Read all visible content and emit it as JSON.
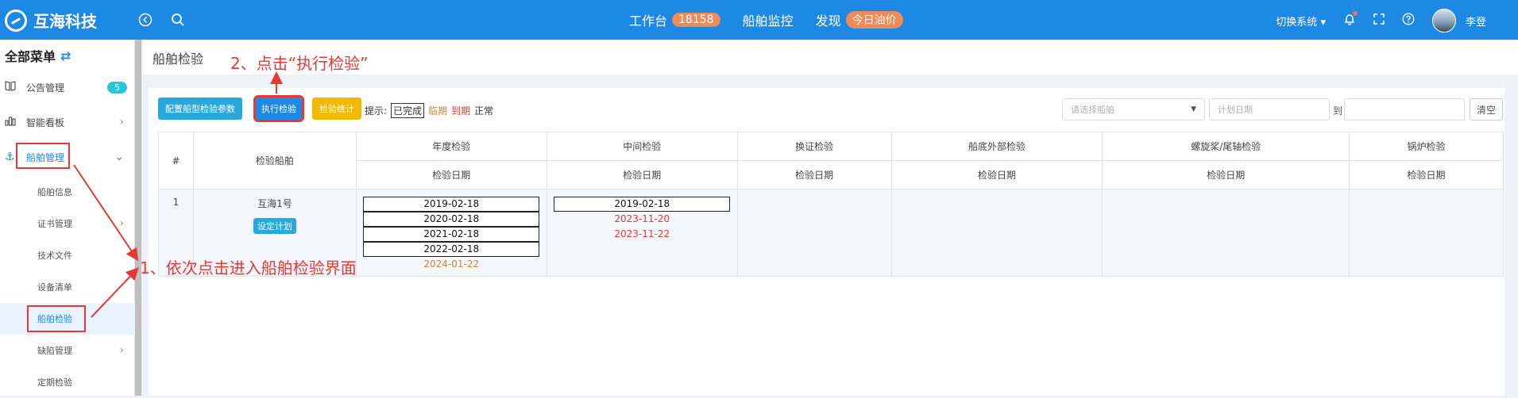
{
  "header": {
    "brand": "互海科技",
    "nav": [
      {
        "label": "工作台",
        "badge": "18158"
      },
      {
        "label": "船舶监控",
        "badge": ""
      },
      {
        "label": "发现",
        "badge": "今日油价"
      }
    ],
    "switch_system": "切换系统",
    "user_name": "李登"
  },
  "sidebar": {
    "title": "全部菜单",
    "items": [
      {
        "label": "公告管理",
        "badge": "5",
        "icon": "book-icon"
      },
      {
        "label": "智能看板",
        "icon": "bar-chart-icon"
      },
      {
        "label": "船舶管理",
        "icon": "anchor-icon"
      }
    ],
    "sub_items": [
      {
        "label": "船舶信息"
      },
      {
        "label": "证书管理"
      },
      {
        "label": "技术文件"
      },
      {
        "label": "设备清单"
      },
      {
        "label": "船舶检验"
      },
      {
        "label": "缺陷管理"
      },
      {
        "label": "定期检验"
      }
    ]
  },
  "page": {
    "title": "船舶检验",
    "toolbar": {
      "config_btn": "配置船型检验参数",
      "execute_btn": "执行检验",
      "stats_btn": "检验统计",
      "hint_label": "提示:",
      "legend_done": "已完成",
      "legend_due_soon": "临期",
      "legend_expired": "到期",
      "legend_normal": "正常",
      "ship_select_placeholder": "请选择船舶",
      "plan_date_placeholder": "计划日期",
      "to_label": "到",
      "reset_btn": "清空"
    },
    "table": {
      "col_index": "#",
      "col_ship": "检验船舶",
      "groups": [
        "年度检验",
        "中间检验",
        "换证检验",
        "船底外部检验",
        "螺旋桨/尾轴检验",
        "锅炉检验"
      ],
      "sub_header": "检验日期",
      "rows": [
        {
          "index": "1",
          "ship": "互海1号",
          "plan_btn": "设定计划",
          "annual_done": [
            "2019-02-18",
            "2020-02-18",
            "2021-02-18",
            "2022-02-18"
          ],
          "annual_upcoming": "2024-01-22",
          "intermediate_done": [
            "2019-02-18"
          ],
          "intermediate_due": [
            "2023-11-20",
            "2023-11-22"
          ]
        }
      ]
    }
  },
  "annotations": {
    "step1": "1、依次点击进入船舶检验界面",
    "step2": "2、点击“执行检验”"
  },
  "colors": {
    "primary": "#1e88e5",
    "annotation": "#e53935",
    "warning_btn": "#f5b800",
    "orange_date": "#c8883a"
  }
}
